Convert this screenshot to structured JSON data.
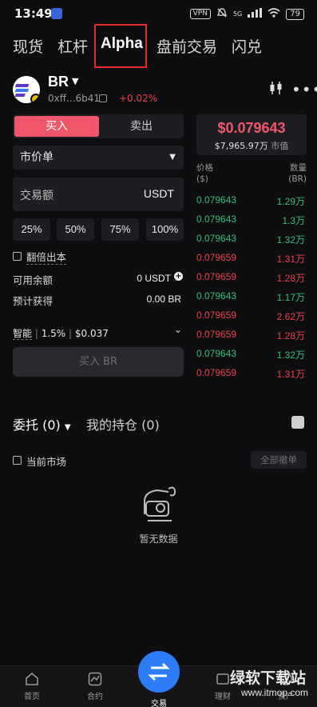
{
  "status_bar": {
    "time": "13:49",
    "vpn": "VPN",
    "network": "5G",
    "battery": "79"
  },
  "top_tabs": [
    "现货",
    "杠杆",
    "Alpha",
    "盘前交易",
    "闪兑"
  ],
  "token": {
    "symbol": "BR",
    "address": "0xff...6b41",
    "change": "+0.02%"
  },
  "trade": {
    "buy_label": "买入",
    "sell_label": "卖出",
    "order_type": "市价单",
    "amount_placeholder": "交易额",
    "amount_unit": "USDT",
    "percents": [
      "25%",
      "50%",
      "75%",
      "100%"
    ],
    "double_label": "翻倍出本",
    "balance_label": "可用余额",
    "balance_value": "0 USDT",
    "estimate_label": "预计获得",
    "estimate_value": "0.00 BR",
    "smart_label": "智能",
    "smart_slippage": "1.5%",
    "smart_fee": "$0.037",
    "buy_button": "买入 BR"
  },
  "price_panel": {
    "price": "$0.079643",
    "market_cap": "$7,965.97万",
    "market_cap_label": "市值",
    "col_price": "价格",
    "col_price_unit": "($)",
    "col_qty": "数量",
    "col_qty_unit": "(BR)",
    "rows": [
      {
        "price": "0.079643",
        "qty": "1.29万",
        "side": "buy"
      },
      {
        "price": "0.079643",
        "qty": "1.3万",
        "side": "buy"
      },
      {
        "price": "0.079643",
        "qty": "1.32万",
        "side": "buy"
      },
      {
        "price": "0.079659",
        "qty": "1.31万",
        "side": "sell"
      },
      {
        "price": "0.079659",
        "qty": "1.28万",
        "side": "sell"
      },
      {
        "price": "0.079643",
        "qty": "1.17万",
        "side": "buy"
      },
      {
        "price": "0.079659",
        "qty": "2.62万",
        "side": "sell"
      },
      {
        "price": "0.079659",
        "qty": "1.28万",
        "side": "sell"
      },
      {
        "price": "0.079643",
        "qty": "1.32万",
        "side": "buy"
      },
      {
        "price": "0.079659",
        "qty": "1.31万",
        "side": "sell"
      }
    ]
  },
  "orders": {
    "tab_orders": "委托 (0)",
    "tab_positions": "我的持仓 (0)",
    "current_market": "当前市场",
    "cancel_all": "全部撤单",
    "empty": "暂无数据"
  },
  "bottom_nav": [
    "首页",
    "合约",
    "交易",
    "理财",
    "资产"
  ],
  "watermark": {
    "line1": "绿软下载站",
    "line2": "www.itmop.com"
  },
  "colors": {
    "buy": "#37bb7a",
    "sell": "#e8414a",
    "accent": "#f0576b",
    "fab": "#2b7cf6"
  }
}
